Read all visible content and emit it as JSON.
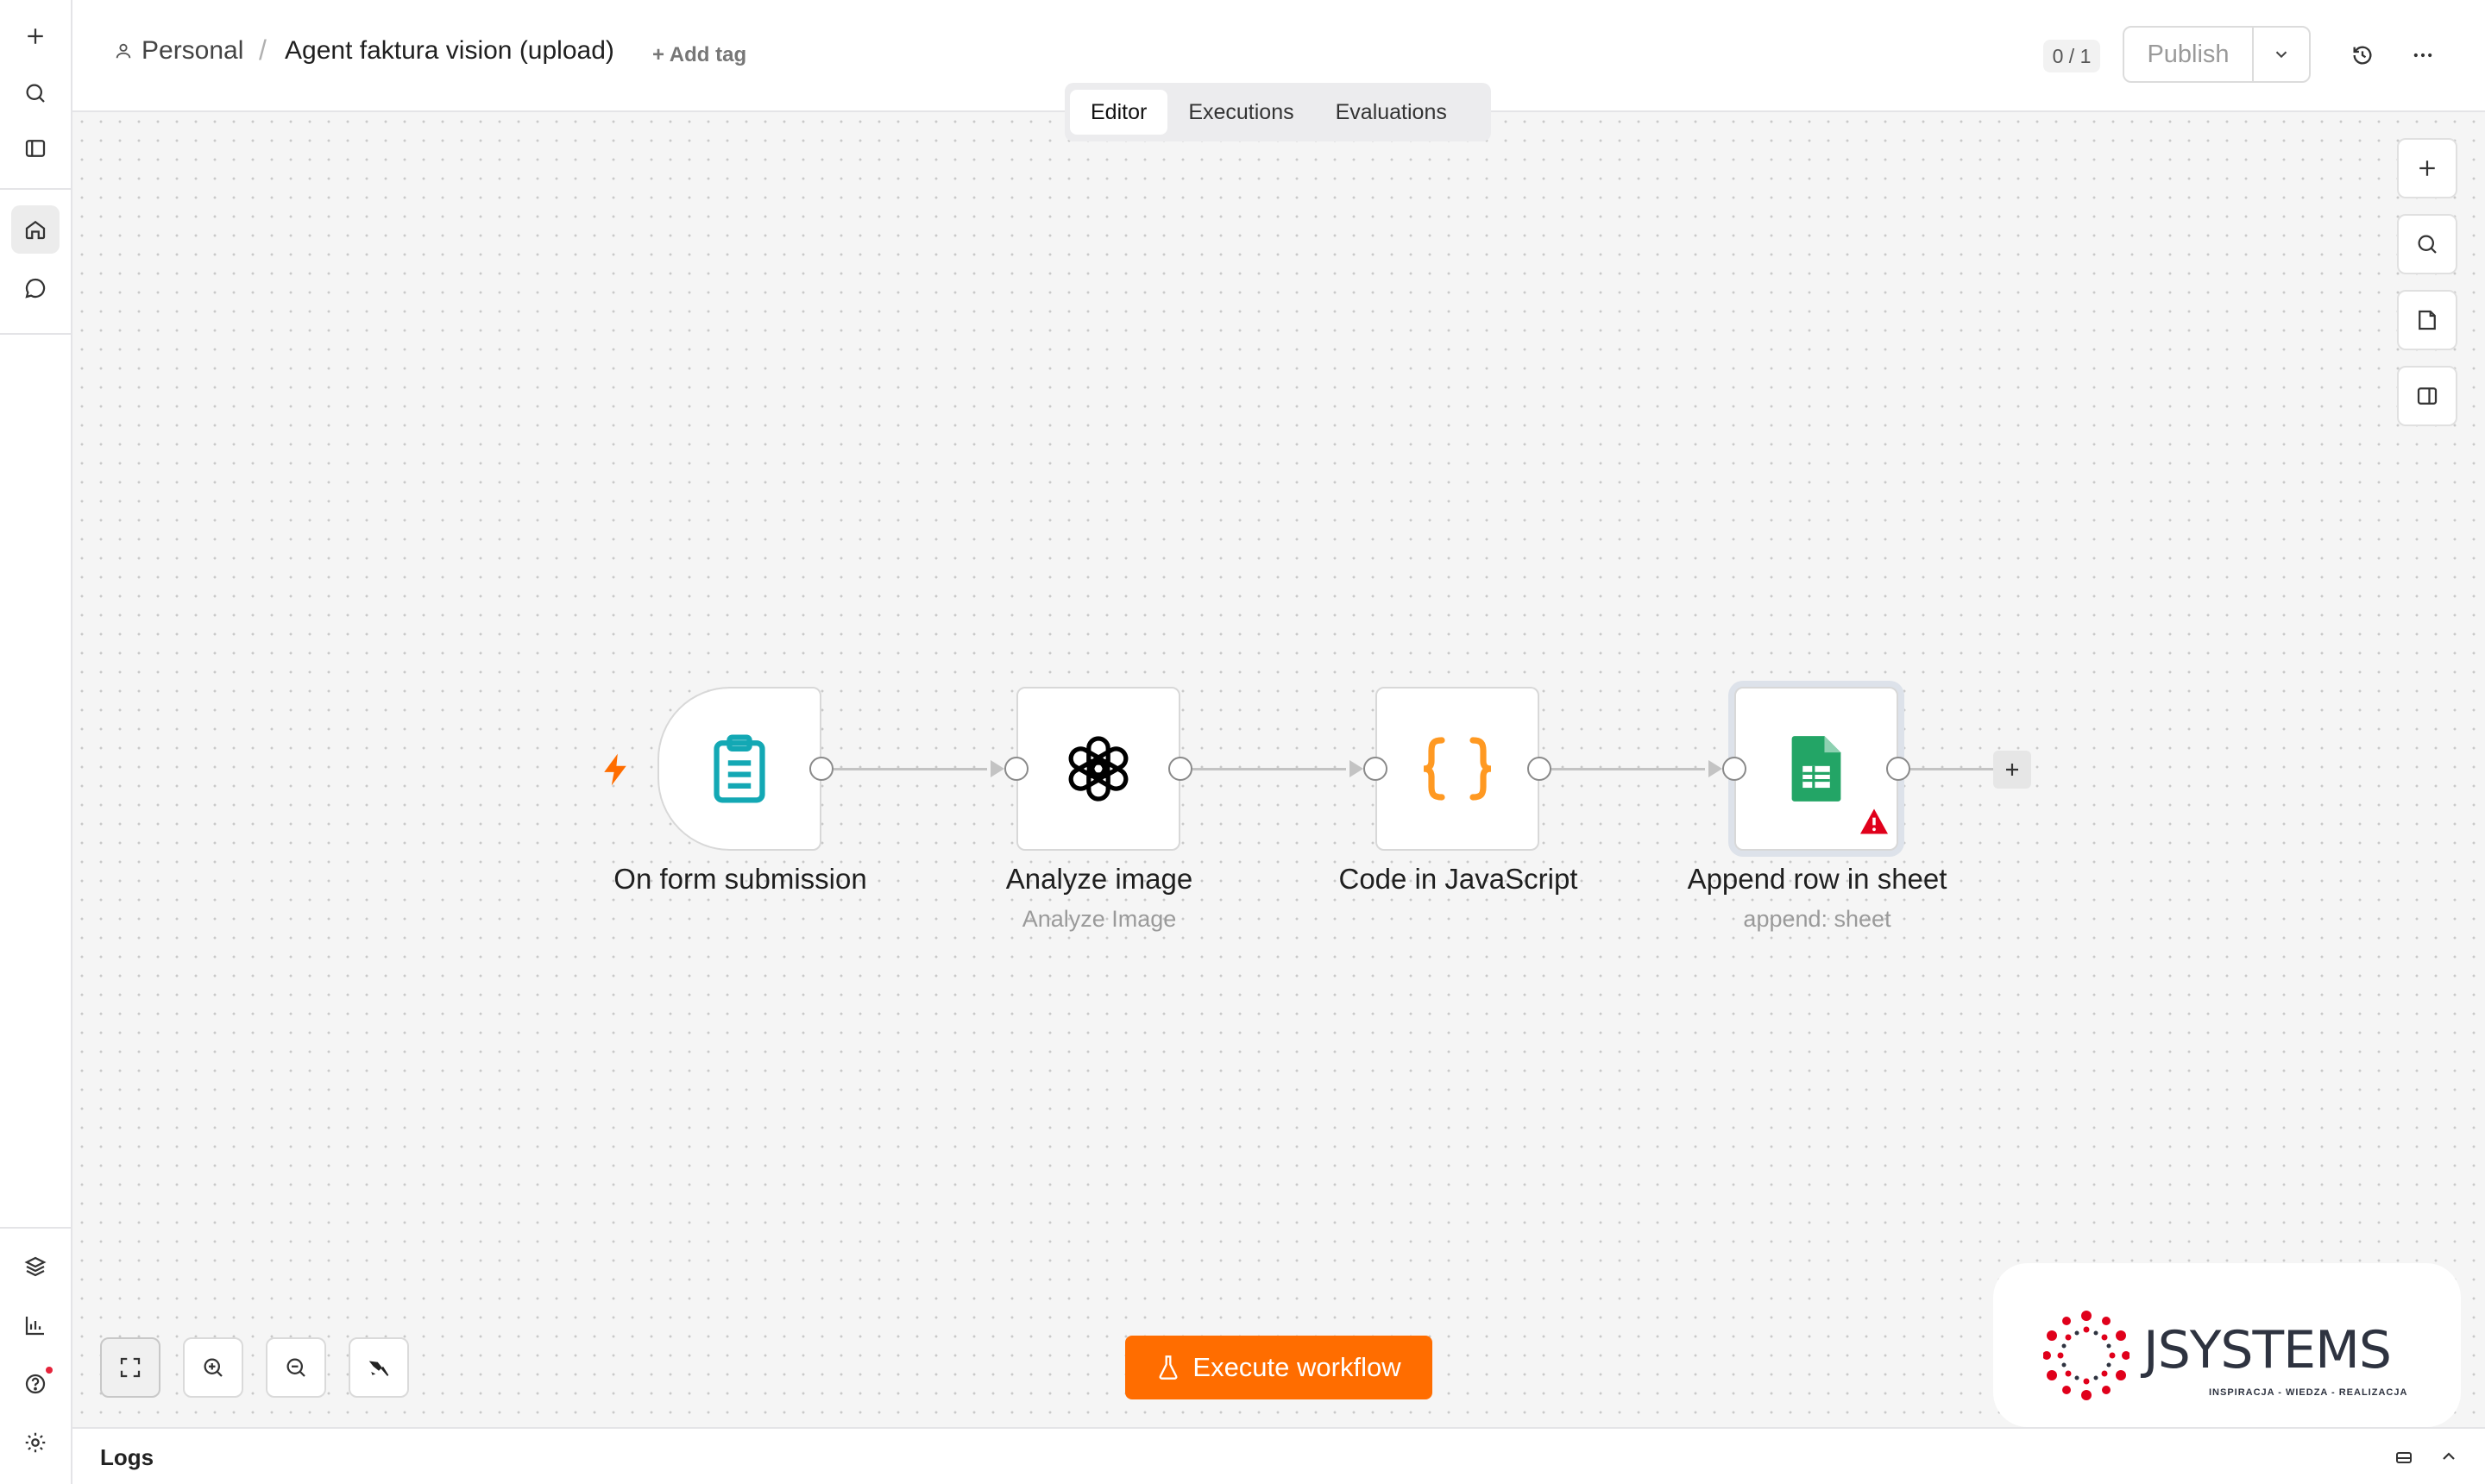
{
  "header": {
    "project": "Personal",
    "separator": "/",
    "workflow_title": "Agent faktura vision (upload)",
    "add_tag": "+ Add tag",
    "counter": "0 / 1",
    "publish": "Publish"
  },
  "tabs": [
    {
      "label": "Editor",
      "active": true
    },
    {
      "label": "Executions",
      "active": false
    },
    {
      "label": "Evaluations",
      "active": false
    }
  ],
  "nodes": [
    {
      "label": "On form submission",
      "subtitle": "",
      "icon": "form-clipboard-icon",
      "color": "#13a8b4"
    },
    {
      "label": "Analyze image",
      "subtitle": "Analyze Image",
      "icon": "openai-icon",
      "color": "#000000"
    },
    {
      "label": "Code in JavaScript",
      "subtitle": "",
      "icon": "code-braces-icon",
      "color": "#ff9922"
    },
    {
      "label": "Append row in sheet",
      "subtitle": "append: sheet",
      "icon": "google-sheets-icon",
      "color": "#23a566",
      "warning": true
    }
  ],
  "execute_button": "Execute workflow",
  "logs_label": "Logs",
  "logo": {
    "word": "JSYSTEMS",
    "tagline": "INSPIRACJA - WIEDZA - REALIZACJA"
  },
  "colors": {
    "accent": "#ff6d00",
    "trigger_bolt": "#ff6d00",
    "warning": "#e0001b",
    "canvas": "#f5f5f5"
  }
}
